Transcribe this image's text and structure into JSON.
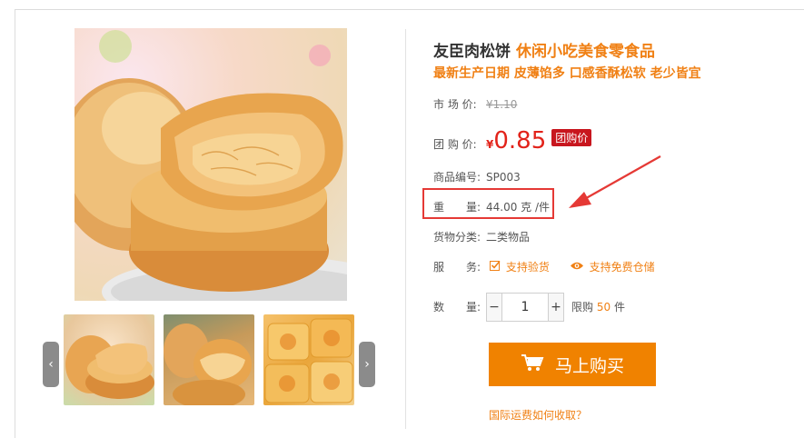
{
  "product": {
    "name": "友臣肉松饼",
    "name_suffix": "休闲小吃美食零食品",
    "tagline": "最新生产日期 皮薄馅多 口感香酥松软 老少皆宜"
  },
  "pricing": {
    "market_label": "市 场 价:",
    "market_price": "¥1.10",
    "group_label": "团 购 价:",
    "currency": "¥",
    "group_price": "0.85",
    "group_badge": "团购价"
  },
  "details": {
    "sku_label": "商品编号:",
    "sku": "SP003",
    "weight_label": "重　　量:",
    "weight": "44.00 克 /件",
    "category_label": "货物分类:",
    "category": "二类物品",
    "service_label": "服　　务:",
    "services": [
      "支持验货",
      "支持免费仓储"
    ]
  },
  "quantity": {
    "label": "数　　量:",
    "minus": "−",
    "value": "1",
    "plus": "+",
    "limit_prefix": "限购",
    "limit_value": "50",
    "limit_unit": "件"
  },
  "actions": {
    "buy_label": "马上购买",
    "shipping_link": "国际运费如何收取？"
  },
  "gallery": {
    "prev": "‹",
    "next": "›"
  },
  "colors": {
    "accent": "#f08014",
    "price_red": "#e2231a",
    "badge_red": "#c8161e",
    "buy_button": "#f08200",
    "highlight_box": "#e53935"
  },
  "icons": [
    "checkbox-icon",
    "eye-icon",
    "cart-icon"
  ]
}
